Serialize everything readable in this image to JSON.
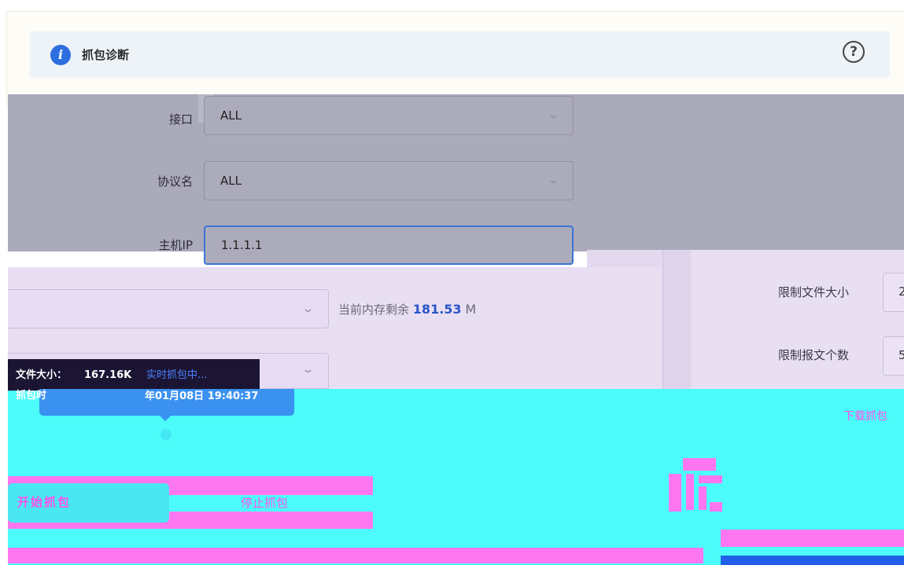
{
  "header": {
    "title": "抓包诊断",
    "info_icon": "info-icon",
    "help_icon": "help-icon"
  },
  "form": {
    "interface": {
      "label": "接口",
      "value": "ALL"
    },
    "protocol": {
      "label": "协议名",
      "value": "ALL"
    },
    "host_ip": {
      "label": "主机IP",
      "value": "1.1.1.1"
    },
    "memory_remaining": {
      "label": "当前内存剩余",
      "value": "181.53",
      "unit": "M"
    },
    "limit_file_size": {
      "label": "限制文件大小",
      "value": "2"
    },
    "limit_packet_count": {
      "label": "限制报文个数",
      "value": "5"
    }
  },
  "tooltip": {
    "file_size_label": "文件大小：",
    "file_size_value": "167.16K",
    "status": "实时抓包中...",
    "capture_time_label": "抓包时",
    "capture_time_value": "年01月08日 19:40:37"
  },
  "actions": {
    "start_label": "开始抓包",
    "stop_label": "停止抓包",
    "download_label": "下载抓包"
  },
  "colors": {
    "accent": "#2d6fe0",
    "memory_value": "#2a55c8",
    "artifact_cyan": "#4cfcfa",
    "artifact_magenta": "#ff77f0"
  }
}
